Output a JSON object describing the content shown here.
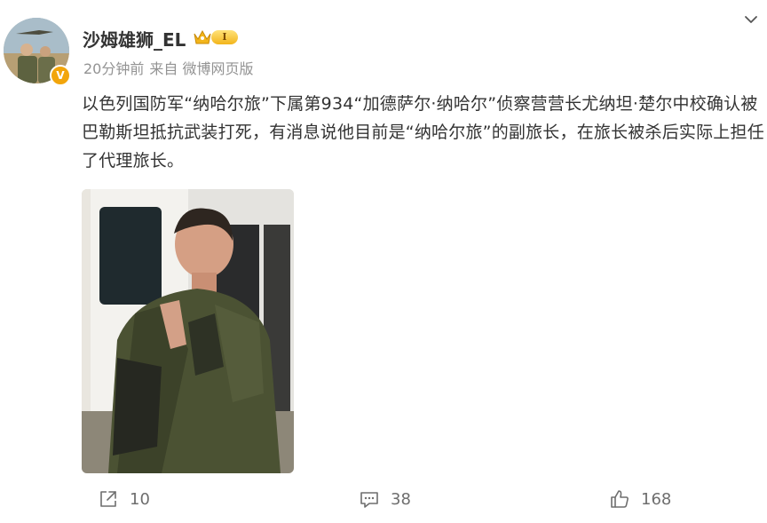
{
  "post": {
    "username": "沙姆雄狮_EL",
    "verified_mark": "V",
    "level_label": "I",
    "time": "20分钟前",
    "source": "来自 微博网页版",
    "text": "以色列国防军“纳哈尔旅”下属第934“加德萨尔·纳哈尔”侦察营营长尤纳坦·楚尔中校确认被巴勒斯坦抵抗武装打死，有消息说他目前是“纳哈尔旅”的副旅长，在旅长被杀后实际上担任了代理旅长。"
  },
  "actions": {
    "repost_count": "10",
    "comment_count": "38",
    "like_count": "168"
  },
  "icons": {
    "menu": "chevron-down-icon",
    "repost": "share-icon",
    "comment": "comment-icon",
    "like": "thumbs-up-icon",
    "member": "crown-icon"
  },
  "colors": {
    "text": "#333333",
    "meta": "#939393",
    "action": "#6e6e6e",
    "verified": "#f2a50b",
    "crown": "#f2b51b"
  }
}
